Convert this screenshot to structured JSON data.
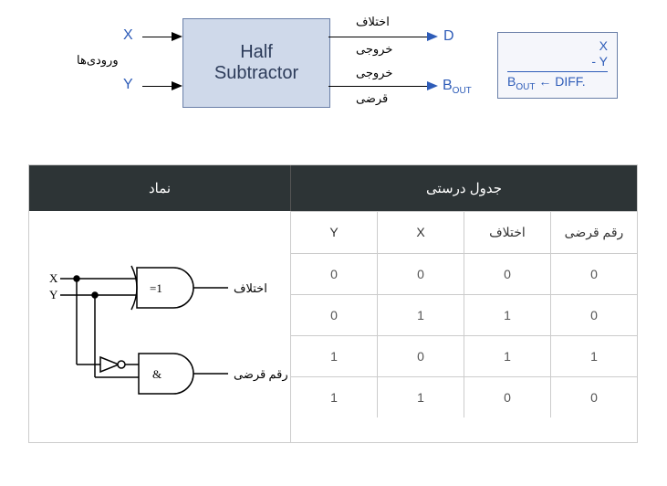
{
  "block": {
    "inputs_label": "ورودی‌ها",
    "x": "X",
    "y": "Y",
    "box_line1": "Half",
    "box_line2": "Subtractor",
    "diff_label_top": "اختلاف",
    "diff_label_bottom": "خروجی",
    "borrow_label_top": "خروجی",
    "borrow_label_bottom": "قرضی",
    "d": "D",
    "bout_prefix": "B",
    "bout_sub": "OUT"
  },
  "calc": {
    "l1": "X",
    "l2": "- Y",
    "l3_prefix": "B",
    "l3_sub": "OUT",
    "l3_arrow": " ← ",
    "l3_diff": "DIFF."
  },
  "symbol": {
    "x": "X",
    "y": "Y",
    "xor_tag": "=1",
    "and_tag": "&",
    "diff_out": "اختلاف",
    "borrow_out": "رقم قرضی"
  },
  "truth": {
    "sym_header": "نماد",
    "tt_header": "جدول درستی",
    "cols": [
      "Y",
      "X",
      "اختلاف",
      "رقم قرضی"
    ],
    "rows": [
      [
        "0",
        "0",
        "0",
        "0"
      ],
      [
        "0",
        "1",
        "1",
        "0"
      ],
      [
        "1",
        "0",
        "1",
        "1"
      ],
      [
        "1",
        "1",
        "0",
        "0"
      ]
    ]
  },
  "chart_data": {
    "type": "table",
    "title": "Half Subtractor — block diagram, gate-level symbol, and truth table",
    "columns": [
      "Y",
      "X",
      "اختلاف (Difference)",
      "رقم قرضی (Borrow)"
    ],
    "rows": [
      {
        "Y": 0,
        "X": 0,
        "Difference": 0,
        "Borrow": 0
      },
      {
        "Y": 0,
        "X": 1,
        "Difference": 1,
        "Borrow": 0
      },
      {
        "Y": 1,
        "X": 0,
        "Difference": 1,
        "Borrow": 1
      },
      {
        "Y": 1,
        "X": 1,
        "Difference": 0,
        "Borrow": 0
      }
    ],
    "logic": {
      "Difference": "X XOR Y",
      "Borrow": "(NOT X) AND Y"
    }
  }
}
